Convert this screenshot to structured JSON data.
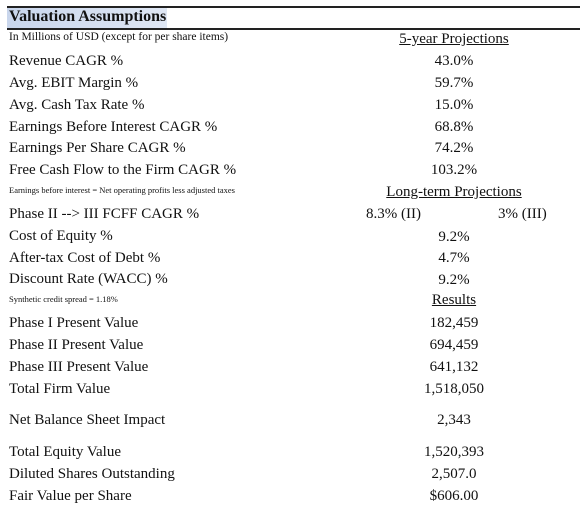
{
  "header": {
    "title": "Valuation Assumptions",
    "subtitle": "In Millions of USD (except for per share items)",
    "highlight_color": "#d3def0"
  },
  "sections": {
    "five_year": {
      "heading": "5-year Projections",
      "rows": [
        {
          "label": "Revenue CAGR %",
          "value": "43.0%"
        },
        {
          "label": "Avg. EBIT Margin %",
          "value": "59.7%"
        },
        {
          "label": "Avg. Cash Tax Rate %",
          "value": "15.0%"
        },
        {
          "label": "Earnings Before Interest CAGR %",
          "value": "68.8%"
        },
        {
          "label": "Earnings Per Share CAGR %",
          "value": "74.2%"
        },
        {
          "label": "Free Cash Flow to the Firm CAGR %",
          "value": "103.2%"
        }
      ],
      "note": "Earnings before interest = Net operating profits less adjusted taxes"
    },
    "long_term": {
      "heading": "Long-term Projections",
      "phase_row": {
        "label": "Phase II --> III FCFF CAGR %",
        "value_ii": "8.3% (II)",
        "value_iii": "3% (III)"
      },
      "rows": [
        {
          "label": "Cost of Equity %",
          "value": "9.2%"
        },
        {
          "label": "After-tax Cost of Debt %",
          "value": "4.7%"
        },
        {
          "label": "Discount Rate (WACC) %",
          "value": "9.2%"
        }
      ],
      "note": "Synthetic credit spread = 1.18%"
    },
    "results": {
      "heading": "Results",
      "rows": [
        {
          "label": "Phase I Present Value",
          "value": "182,459"
        },
        {
          "label": "Phase II Present Value",
          "value": "694,459"
        },
        {
          "label": "Phase III Present Value",
          "value": "641,132"
        },
        {
          "label": "Total Firm Value",
          "value": "1,518,050"
        }
      ],
      "net_balance": {
        "label": "Net Balance Sheet Impact",
        "value": "2,343"
      },
      "equity_rows": [
        {
          "label": "Total Equity Value",
          "value": "1,520,393"
        },
        {
          "label": "Diluted Shares Outstanding",
          "value": "2,507.0"
        },
        {
          "label": "Fair Value per Share",
          "value": "$606.00"
        }
      ]
    }
  }
}
